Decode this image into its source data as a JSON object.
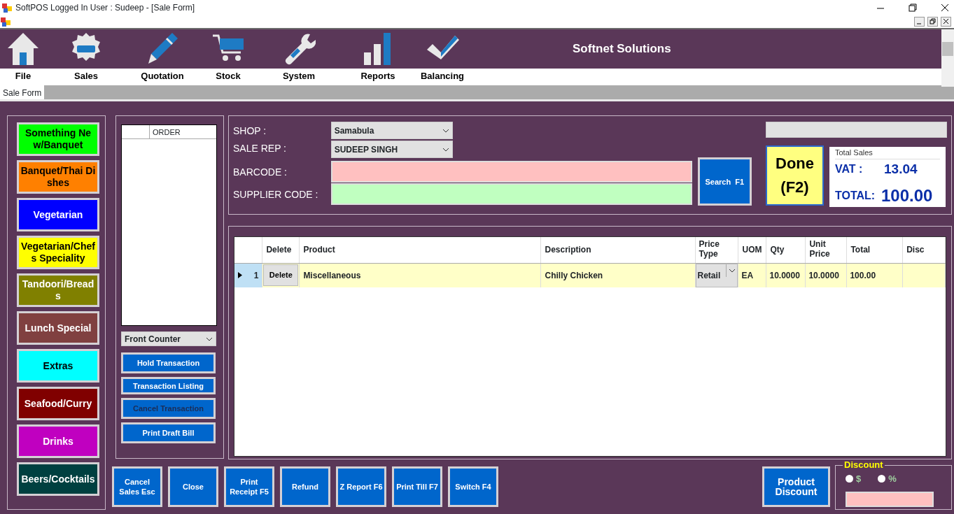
{
  "window": {
    "title": "SoftPOS  Logged In User : Sudeep - [Sale Form]"
  },
  "toolbar": {
    "items": [
      {
        "label": "File"
      },
      {
        "label": "Sales"
      },
      {
        "label": "Quotation"
      },
      {
        "label": "Stock"
      },
      {
        "label": "System"
      },
      {
        "label": "Reports"
      },
      {
        "label": "Balancing"
      }
    ],
    "company": "Softnet Solutions"
  },
  "tabs": [
    {
      "label": "Sale Form",
      "selected": true
    }
  ],
  "categories": [
    {
      "label": "Something New/Banquet",
      "color": "#00ff00"
    },
    {
      "label": "Banquet/Thai Dishes",
      "color": "#ff8000"
    },
    {
      "label": "Vegetarian",
      "color": "#0000ff"
    },
    {
      "label": "Vegetarian/Chefs Speciality",
      "color": "#ffff00"
    },
    {
      "label": "Tandoori/Breads",
      "color": "#808000"
    },
    {
      "label": "Lunch Special",
      "color": "#804040"
    },
    {
      "label": "Extras",
      "color": "#00ffff"
    },
    {
      "label": "Seafood/Curry",
      "color": "#800000"
    },
    {
      "label": "Drinks",
      "color": "#c000c0"
    },
    {
      "label": "Beers/Cocktails",
      "color": "#004040"
    }
  ],
  "order_list": {
    "columns": [
      "ORDER"
    ]
  },
  "counter_select": {
    "value": "Front Counter"
  },
  "side_buttons": [
    {
      "label": "Hold Transaction",
      "disabled": false
    },
    {
      "label": "Transaction Listing",
      "disabled": false
    },
    {
      "label": "Cancel Transaction",
      "disabled": true
    },
    {
      "label": "Print Draft Bill",
      "disabled": false
    }
  ],
  "form": {
    "shop_label": "SHOP :",
    "shop": "Samabula",
    "rep_label": "SALE REP :",
    "rep": "SUDEEP SINGH",
    "barcode_label": "BARCODE :",
    "supplier_label": "SUPPLIER CODE :",
    "search_button": "Search  F1",
    "done_button": "Done (F2)"
  },
  "totals": {
    "title": "Total Sales",
    "vat_label": "VAT :",
    "vat": "13.04",
    "total_label": "TOTAL:",
    "total": "100.00"
  },
  "table": {
    "columns": [
      "Delete",
      "Product",
      "Description",
      "Price Type",
      "UOM",
      "Qty",
      "Unit Price",
      "Total",
      "Disc"
    ],
    "rows": [
      {
        "number": "1",
        "selected": true,
        "delete": "Delete",
        "product": "Miscellaneous",
        "description": "Chilly Chicken",
        "price_type": "Retail",
        "uom": "EA",
        "qty": "10.0000",
        "unit_price": "10.0000",
        "total": "100.00"
      }
    ]
  },
  "bottom_buttons": [
    "Cancel Sales Esc",
    "Close",
    "Print Receipt F5",
    "Refund",
    "Z Report F6",
    "Print Till F7",
    "Switch F4"
  ],
  "product_discount": "Product Discount",
  "discount": {
    "title": "Discount",
    "options": [
      {
        "label": "$",
        "checked": false
      },
      {
        "label": "%",
        "checked": false
      }
    ]
  }
}
